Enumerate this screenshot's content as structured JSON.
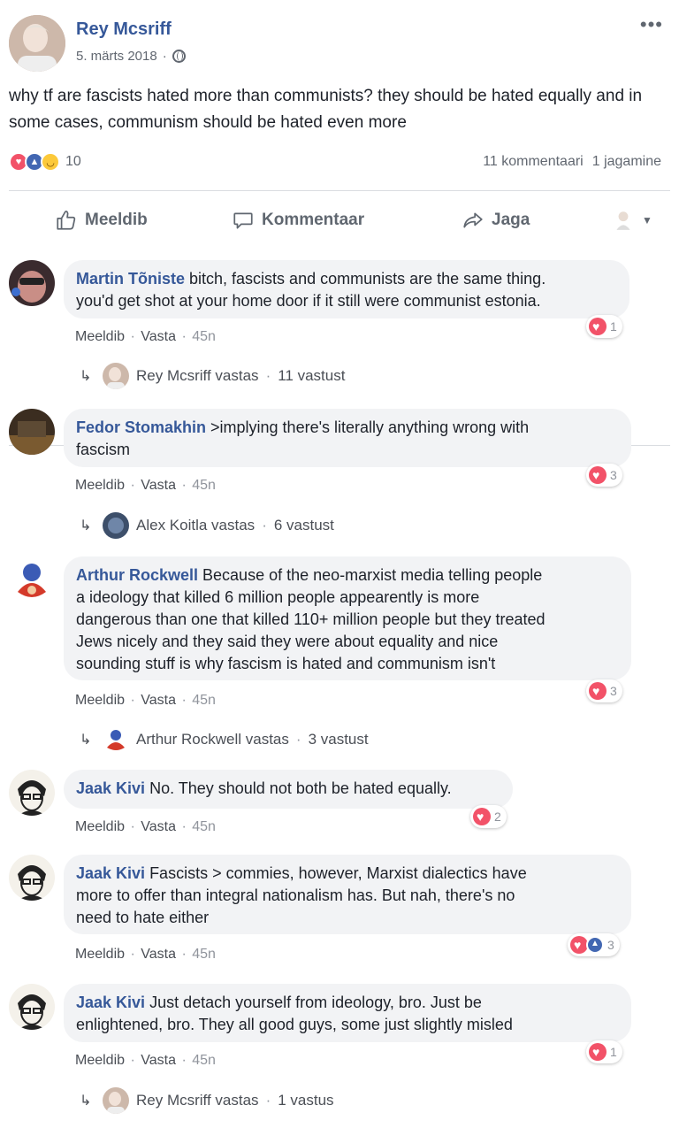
{
  "post": {
    "author": "Rey Mcsriff",
    "date": "5. märts 2018",
    "dot": "·",
    "text": "why tf are fascists hated more than communists? they should be hated equally and in some cases, communism should be hated even more",
    "reaction_count": "10",
    "comments_count": "11 kommentaari",
    "shares_count": "1 jagamine",
    "more_icon": "more-dots-icon"
  },
  "actions": {
    "like": "Meeldib",
    "comment": "Kommentaar",
    "share": "Jaga"
  },
  "comment_actions": {
    "like": "Meeldib",
    "reply": "Vasta",
    "dot": "·"
  },
  "comments": [
    {
      "name": "Martin Tõniste",
      "text_line1": " bitch, fascists and communists are the same thing.",
      "text_line2": "you'd get shot at your home door if it still were communist estonia.",
      "time": "45n",
      "reactions": "1",
      "reply_text": "Rey Mcsriff vastas",
      "reply_count": "11 vastust"
    },
    {
      "name": "Fedor Stomakhin",
      "text_line1": " >implying there's literally anything wrong with",
      "text_line2": "fascism",
      "time": "45n",
      "reactions": "3",
      "reply_text": "Alex Koitla vastas",
      "reply_count": "6 vastust"
    },
    {
      "name": "Arthur Rockwell",
      "text_line1": " Because of the neo-marxist media telling people",
      "text_line2": "a ideology that killed 6 million people appearently is more",
      "text_line3": "dangerous than one that killed 110+ million people but they treated",
      "text_line4": "Jews nicely and they said they were about equality and nice",
      "text_line5": "sounding stuff is why fascism is hated and communism isn't",
      "time": "45n",
      "reactions": "3",
      "reply_text": "Arthur Rockwell vastas",
      "reply_count": "3 vastust"
    },
    {
      "name": "Jaak Kivi",
      "text_line1": " No. They should not both be hated equally.",
      "time": "45n",
      "reactions": "2"
    },
    {
      "name": "Jaak Kivi",
      "text_line1": " Fascists > commies, however, Marxist dialectics have",
      "text_line2": "more to offer than integral nationalism has. But nah, there's no",
      "text_line3": "need to hate either",
      "time": "45n",
      "reactions": "3"
    },
    {
      "name": "Jaak Kivi",
      "text_line1": " Just detach yourself from ideology, bro. Just be",
      "text_line2": "enlightened, bro. They all good guys, some just slightly misled",
      "time": "45n",
      "reactions": "1",
      "reply_text": "Rey Mcsriff vastas",
      "reply_count": "1 vastus"
    }
  ]
}
